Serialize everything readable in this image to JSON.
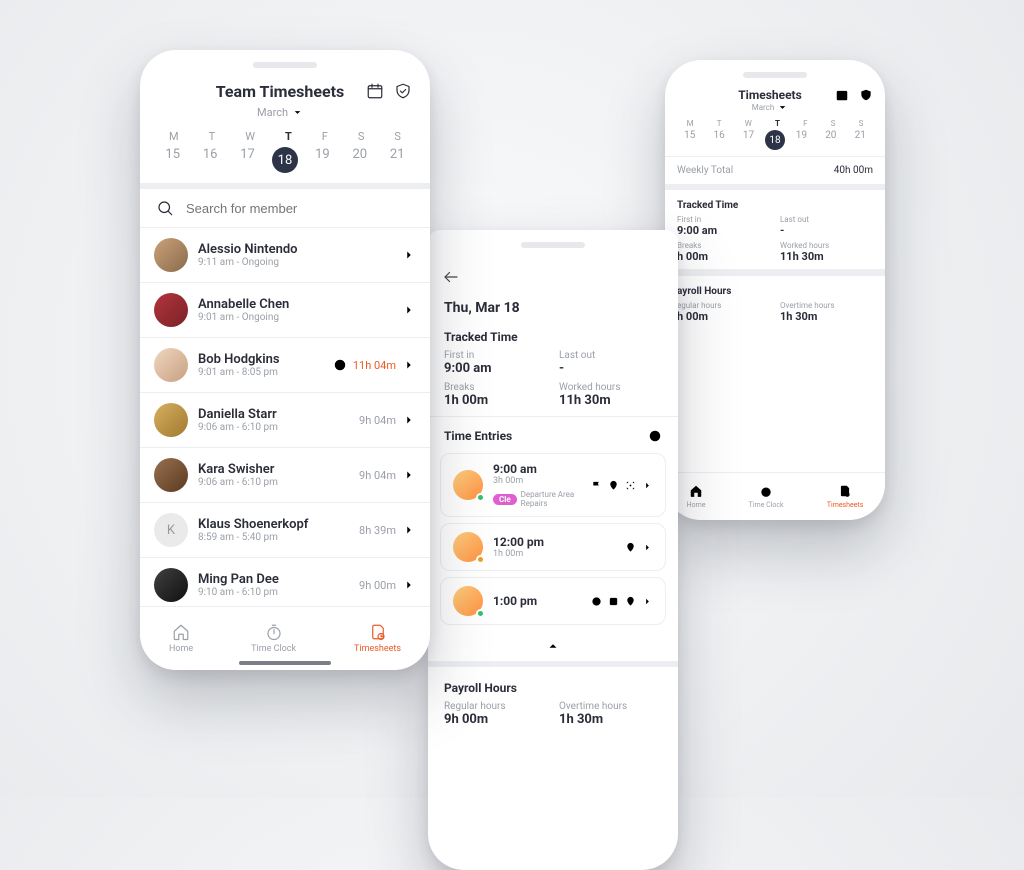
{
  "phone1": {
    "title": "Team Timesheets",
    "month": "March",
    "weekdays": [
      "M",
      "T",
      "W",
      "T",
      "F",
      "S",
      "S"
    ],
    "dates": [
      "15",
      "16",
      "17",
      "18",
      "19",
      "20",
      "21"
    ],
    "selected_index": 3,
    "search_placeholder": "Search for member",
    "members": [
      {
        "name": "Alessio Nintendo",
        "sub": "9:11 am - Ongoing",
        "right": "",
        "accent": false,
        "avatar": "a"
      },
      {
        "name": "Annabelle Chen",
        "sub": "9:01 am - Ongoing",
        "right": "",
        "accent": false,
        "avatar": "b"
      },
      {
        "name": "Bob Hodgkins",
        "sub": "9:01 am - 8:05 pm",
        "right": "11h 04m",
        "accent": true,
        "avatar": "c"
      },
      {
        "name": "Daniella Starr",
        "sub": "9:06 am - 6:10 pm",
        "right": "9h 04m",
        "accent": false,
        "avatar": "d"
      },
      {
        "name": "Kara Swisher",
        "sub": "9:06 am - 6:10 pm",
        "right": "9h 04m",
        "accent": false,
        "avatar": "e"
      },
      {
        "name": "Klaus Shoenerkopf",
        "sub": "8:59 am - 5:40 pm",
        "right": "8h 39m",
        "accent": false,
        "avatar": "f",
        "initial": "K"
      },
      {
        "name": "Ming Pan Dee",
        "sub": "9:10 am - 6:10 pm",
        "right": "9h 00m",
        "accent": false,
        "avatar": "g"
      }
    ],
    "tabs": {
      "home": "Home",
      "clock": "Time Clock",
      "sheets": "Timesheets"
    }
  },
  "phone2": {
    "date_heading": "Thu, Mar 18",
    "tracked_title": "Tracked Time",
    "first_in_label": "First in",
    "first_in_value": "9:00 am",
    "last_out_label": "Last out",
    "last_out_value": "-",
    "breaks_label": "Breaks",
    "breaks_value": "1h 00m",
    "worked_label": "Worked hours",
    "worked_value": "11h 30m",
    "entries_title": "Time Entries",
    "entries": [
      {
        "time": "9:00 am",
        "dur": "3h 00m",
        "status": "g",
        "tag": "Cle",
        "tag_text": "Departure Area Repairs",
        "show_tag": true
      },
      {
        "time": "12:00 pm",
        "dur": "1h 00m",
        "status": "o",
        "show_tag": false
      },
      {
        "time": "1:00 pm",
        "dur": "",
        "status": "g",
        "show_tag": false
      }
    ],
    "payroll_title": "Payroll Hours",
    "regular_label": "Regular hours",
    "regular_value": "9h 00m",
    "overtime_label": "Overtime hours",
    "overtime_value": "1h 30m"
  },
  "phone3": {
    "title": "Timesheets",
    "month": "March",
    "weekdays": [
      "M",
      "T",
      "W",
      "T",
      "F",
      "S",
      "S"
    ],
    "dates": [
      "15",
      "16",
      "17",
      "18",
      "19",
      "20",
      "21"
    ],
    "selected_index": 3,
    "weekly_label": "Weekly Total",
    "weekly_value": "40h 00m",
    "tracked_title": "Tracked Time",
    "first_in_label": "First in",
    "first_in_value": "9:00 am",
    "last_out_label": "Last out",
    "last_out_value": "-",
    "breaks_label": "Breaks",
    "breaks_value": "h 00m",
    "worked_label": "Worked hours",
    "worked_value": "11h 30m",
    "payroll_title": "ayroll Hours",
    "regular_label": "egular hours",
    "regular_value": "h 00m",
    "overtime_label": "Overtime hours",
    "overtime_value": "1h 30m",
    "tabs": {
      "home": "Home",
      "clock": "Time Clock",
      "sheets": "Timesheets"
    }
  }
}
